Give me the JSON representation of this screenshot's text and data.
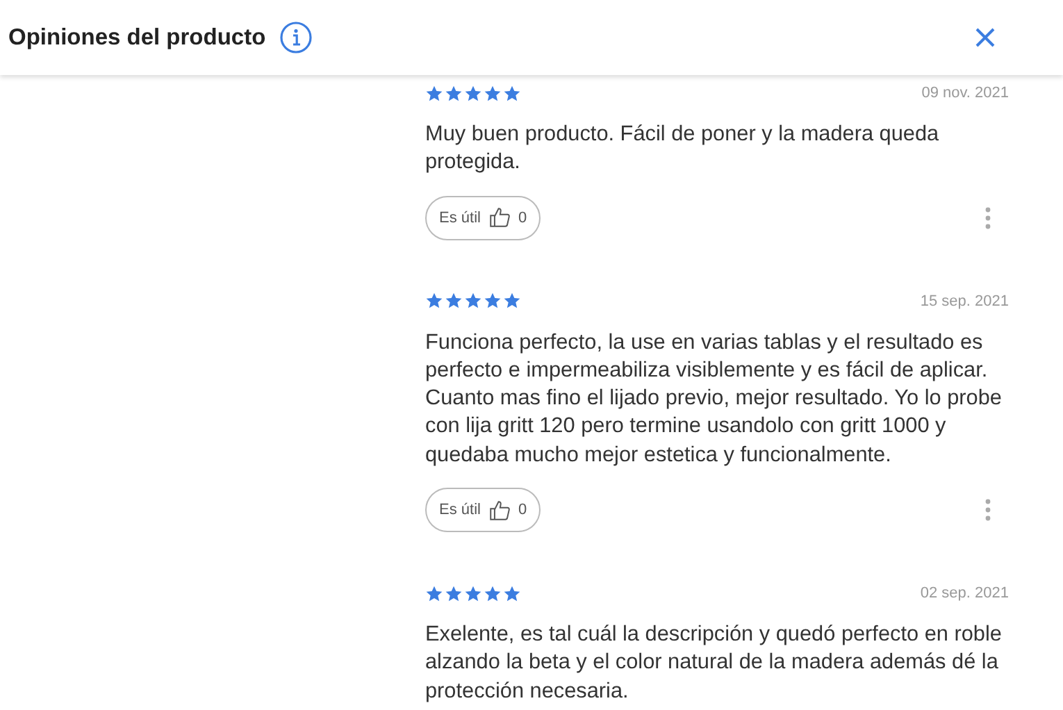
{
  "header": {
    "title": "Opiniones del producto"
  },
  "reviews": [
    {
      "stars": 5,
      "date": "09 nov. 2021",
      "text": "Muy buen producto. Fácil de poner y la madera queda protegida.",
      "helpful_label": "Es útil",
      "helpful_count": "0"
    },
    {
      "stars": 5,
      "date": "15 sep. 2021",
      "text": "Funciona perfecto, la use en varias tablas y el resultado es perfecto e impermeabiliza visiblemente y es fácil de aplicar. Cuanto mas fino el lijado previo, mejor resultado. Yo lo probe con lija gritt 120 pero termine usandolo con gritt 1000 y quedaba mucho mejor estetica y funcionalmente.",
      "helpful_label": "Es útil",
      "helpful_count": "0"
    },
    {
      "stars": 5,
      "date": "02 sep. 2021",
      "text": "Exelente, es tal cuál la descripción y quedó perfecto en roble alzando la beta y el color natural de la madera además dé la protección necesaria."
    }
  ]
}
